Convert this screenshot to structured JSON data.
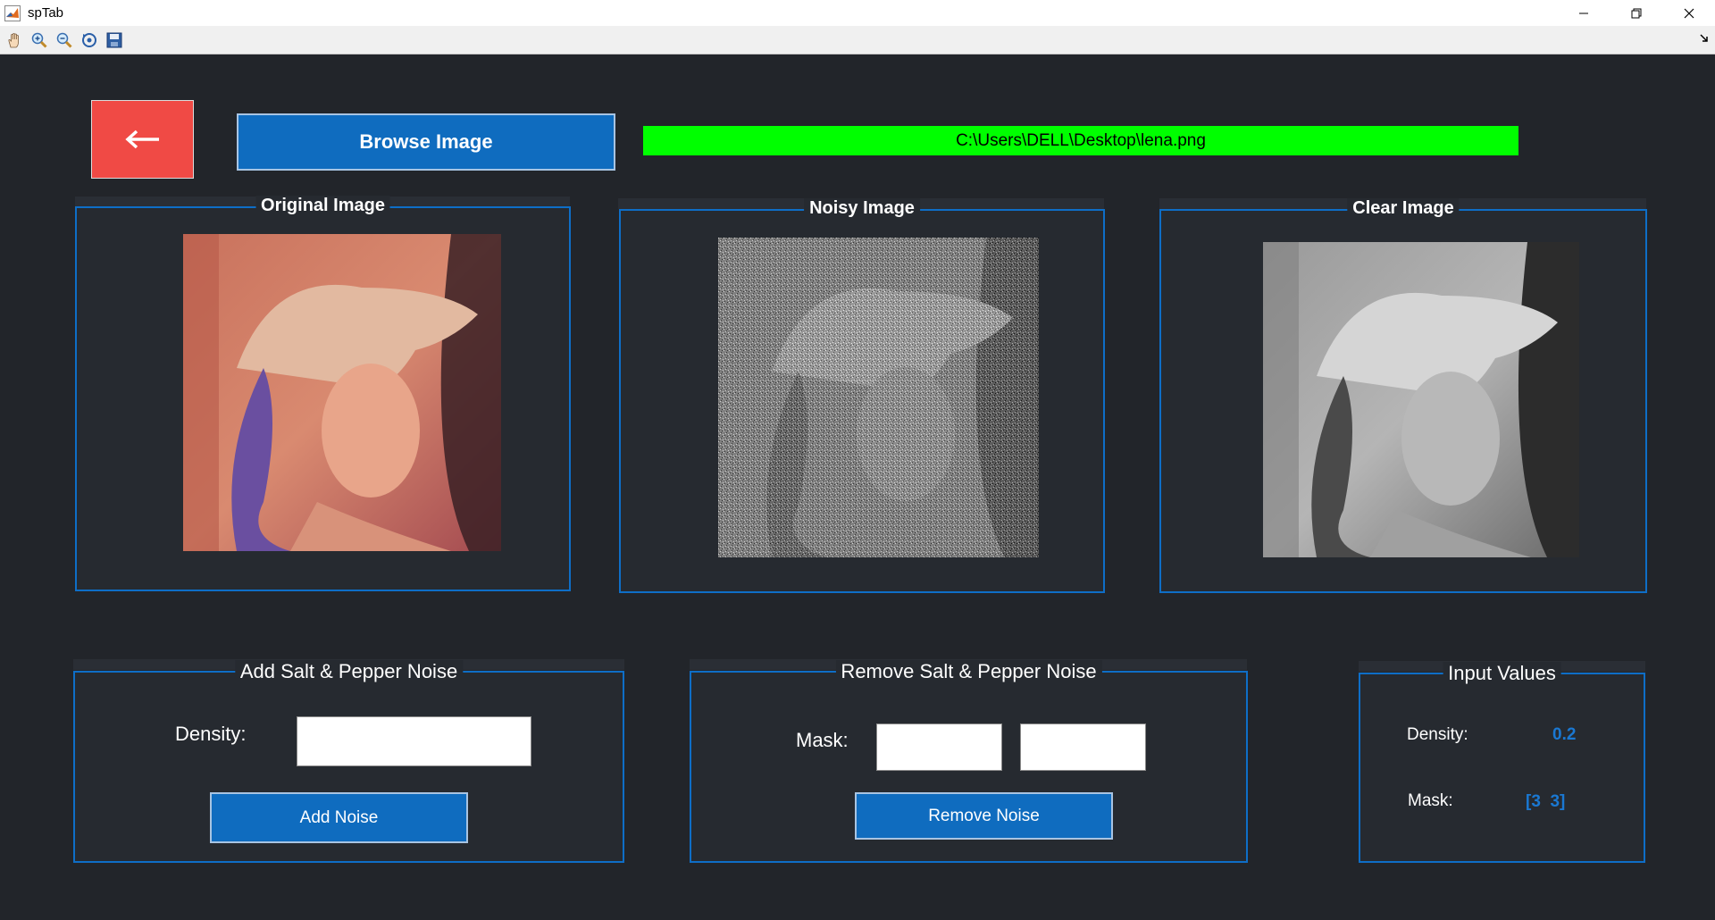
{
  "window": {
    "title": "spTab",
    "icons": [
      "matlab-icon",
      "minimize-icon",
      "restore-icon",
      "close-icon"
    ]
  },
  "toolbar": {
    "tools": [
      "pan-icon",
      "zoom-in-icon",
      "zoom-out-icon",
      "rotate-3d-icon",
      "save-icon"
    ]
  },
  "header": {
    "back_icon": "arrow-left-icon",
    "browse_label": "Browse Image",
    "file_path": "C:\\Users\\DELL\\Desktop\\lena.png"
  },
  "images": {
    "original_title": "Original Image",
    "noisy_title": "Noisy Image",
    "clear_title": "Clear Image"
  },
  "add_noise": {
    "title": "Add Salt & Pepper Noise",
    "density_label": "Density:",
    "density_value": "",
    "button_label": "Add Noise"
  },
  "remove_noise": {
    "title": "Remove Salt & Pepper Noise",
    "mask_label": "Mask:",
    "mask_rows": "",
    "mask_cols": "",
    "button_label": "Remove Noise"
  },
  "input_values": {
    "title": "Input Values",
    "density_label": "Density:",
    "density_value": "0.2",
    "mask_label": "Mask:",
    "mask_value": "[3  3]"
  },
  "colors": {
    "background": "#22252a",
    "accent_blue": "#0f6cbf",
    "back_red": "#f04a45",
    "path_green": "#00ff00",
    "value_blue": "#1a78d2"
  }
}
